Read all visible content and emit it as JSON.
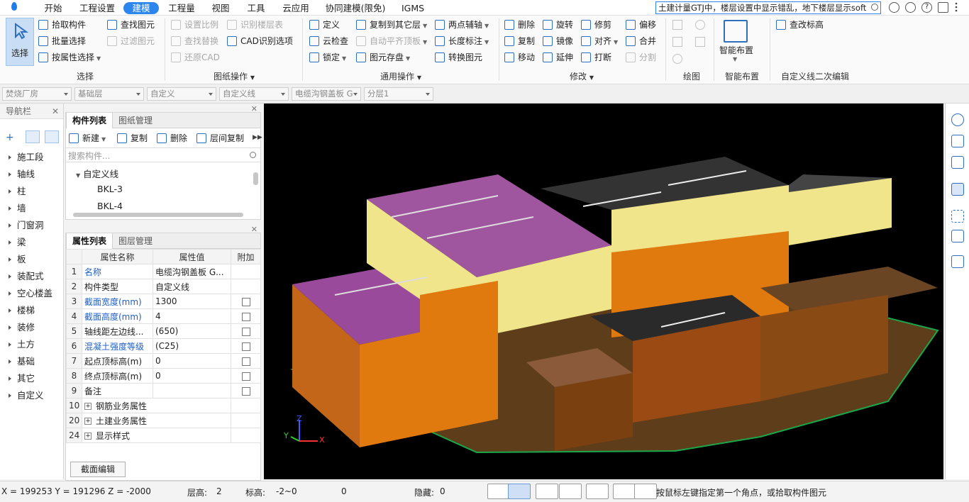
{
  "menu": {
    "tabs": [
      "开始",
      "工程设置",
      "建模",
      "工程量",
      "视图",
      "工具",
      "云应用",
      "协同建模(限免)",
      "IGMS"
    ],
    "active_tab": "建模",
    "search_text": "土建计量GTJ中，楼层设置中显示错乱，地下楼层显示soft"
  },
  "ribbon": {
    "select": {
      "big_button": "选择",
      "items": [
        "拾取构件",
        "批量选择",
        "按属性选择"
      ],
      "items2": [
        "查找图元",
        "过滤图元"
      ],
      "group_label": "选择"
    },
    "drawing_ops": {
      "items": [
        "设置比例",
        "查找替换",
        "还原CAD"
      ],
      "items2": [
        "识别楼层表",
        "CAD识别选项"
      ],
      "group_label": "图纸操作"
    },
    "common_ops": {
      "items": [
        "定义",
        "云检查",
        "锁定"
      ],
      "items2": [
        "复制到其它层",
        "自动平齐顶板",
        "图元存盘"
      ],
      "items3": [
        "两点辅轴",
        "长度标注",
        "转换图元"
      ],
      "group_label": "通用操作"
    },
    "modify": {
      "items": [
        "删除",
        "复制",
        "移动"
      ],
      "items2": [
        "旋转",
        "镜像",
        "延伸"
      ],
      "items3": [
        "修剪",
        "对齐",
        "打断"
      ],
      "items4": [
        "偏移",
        "合并",
        "分割"
      ],
      "group_label": "修改"
    },
    "draw": {
      "group_label": "绘图"
    },
    "smart": {
      "button": "智能布置",
      "group_label": "智能布置"
    },
    "custom_line": {
      "button": "查改标高",
      "group_label": "自定义线二次编辑"
    }
  },
  "layerbar": [
    "焚烧厂房",
    "基础层",
    "自定义",
    "自定义线",
    "电缆沟钢盖板 G",
    "分层1"
  ],
  "nav": {
    "title": "导航栏",
    "items": [
      "施工段",
      "轴线",
      "柱",
      "墙",
      "门窗洞",
      "梁",
      "板",
      "装配式",
      "空心楼盖",
      "楼梯",
      "装修",
      "土方",
      "基础",
      "其它",
      "自定义"
    ]
  },
  "component_panel": {
    "tabs": [
      "构件列表",
      "图纸管理"
    ],
    "toolbar": [
      "新建",
      "复制",
      "删除",
      "层间复制"
    ],
    "search_placeholder": "搜索构件...",
    "tree_root": "自定义线",
    "tree_items": [
      "BKL-3",
      "BKL-4"
    ]
  },
  "property_panel": {
    "tabs": [
      "属性列表",
      "图层管理"
    ],
    "headers": [
      "属性名称",
      "属性值",
      "附加"
    ],
    "rows": [
      {
        "no": "1",
        "name": "名称",
        "value": "电缆沟钢盖板 G...",
        "blue": true,
        "checkbox": false,
        "expand": false
      },
      {
        "no": "2",
        "name": "构件类型",
        "value": "自定义线",
        "blue": false,
        "checkbox": false,
        "expand": false
      },
      {
        "no": "3",
        "name": "截面宽度(mm)",
        "value": "1300",
        "blue": true,
        "checkbox": true,
        "expand": false
      },
      {
        "no": "4",
        "name": "截面高度(mm)",
        "value": "4",
        "blue": true,
        "checkbox": true,
        "expand": false
      },
      {
        "no": "5",
        "name": "轴线距左边线...",
        "value": "(650)",
        "blue": false,
        "checkbox": true,
        "expand": false
      },
      {
        "no": "6",
        "name": "混凝土强度等级",
        "value": "(C25)",
        "blue": true,
        "checkbox": true,
        "expand": false
      },
      {
        "no": "7",
        "name": "起点顶标高(m)",
        "value": "0",
        "blue": false,
        "checkbox": true,
        "expand": false
      },
      {
        "no": "8",
        "name": "终点顶标高(m)",
        "value": "0",
        "blue": false,
        "checkbox": true,
        "expand": false
      },
      {
        "no": "9",
        "name": "备注",
        "value": "",
        "blue": false,
        "checkbox": true,
        "expand": false
      },
      {
        "no": "10",
        "name": "钢筋业务属性",
        "value": "",
        "blue": false,
        "checkbox": false,
        "expand": true
      },
      {
        "no": "20",
        "name": "土建业务属性",
        "value": "",
        "blue": false,
        "checkbox": false,
        "expand": true
      },
      {
        "no": "24",
        "name": "显示样式",
        "value": "",
        "blue": false,
        "checkbox": false,
        "expand": true
      }
    ],
    "edit_button": "截面编辑"
  },
  "axes": {
    "x": "X",
    "y": "Y",
    "z": "Z"
  },
  "status": {
    "coords": "X = 199253 Y = 191296 Z = -2000",
    "floor_height_label": "层高:",
    "floor_height": "2",
    "elevation_label": "标高:",
    "elevation": "-2~0",
    "count": "0",
    "hidden_label": "隐藏:",
    "hidden": "0",
    "hint": "按鼠标左键指定第一个角点，或拾取构件图元"
  },
  "colors": {
    "accent": "#2d86ee",
    "selected": "#c9ddf5",
    "viewport_bg": "#000000"
  }
}
